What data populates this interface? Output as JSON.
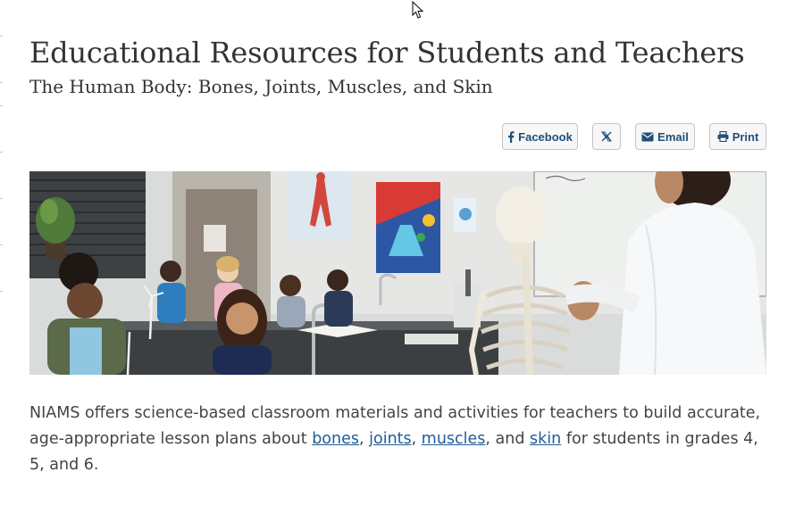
{
  "page": {
    "title": "Educational Resources for Students and Teachers",
    "subtitle": "The Human Body: Bones, Joints, Muscles, and Skin"
  },
  "share": {
    "facebook": "Facebook",
    "email": "Email",
    "print": "Print",
    "icons": [
      "facebook-icon",
      "x-logo-icon",
      "envelope-icon",
      "printer-icon"
    ]
  },
  "intro": {
    "text_before": "NIAMS offers science-based classroom materials and activities for teachers to build accurate, age-appropriate lesson plans about ",
    "link_bones": "bones",
    "sep1": ", ",
    "link_joints": "joints",
    "sep2": ", ",
    "link_muscles": "muscles",
    "sep3": ", and ",
    "link_skin": "skin",
    "text_after": " for students in grades 4, 5, and 6."
  },
  "colors": {
    "link": "#1f5c99",
    "button_text": "#1f4e79",
    "button_border": "#c4c4c4",
    "heading": "#333333",
    "body_text": "#444444"
  }
}
